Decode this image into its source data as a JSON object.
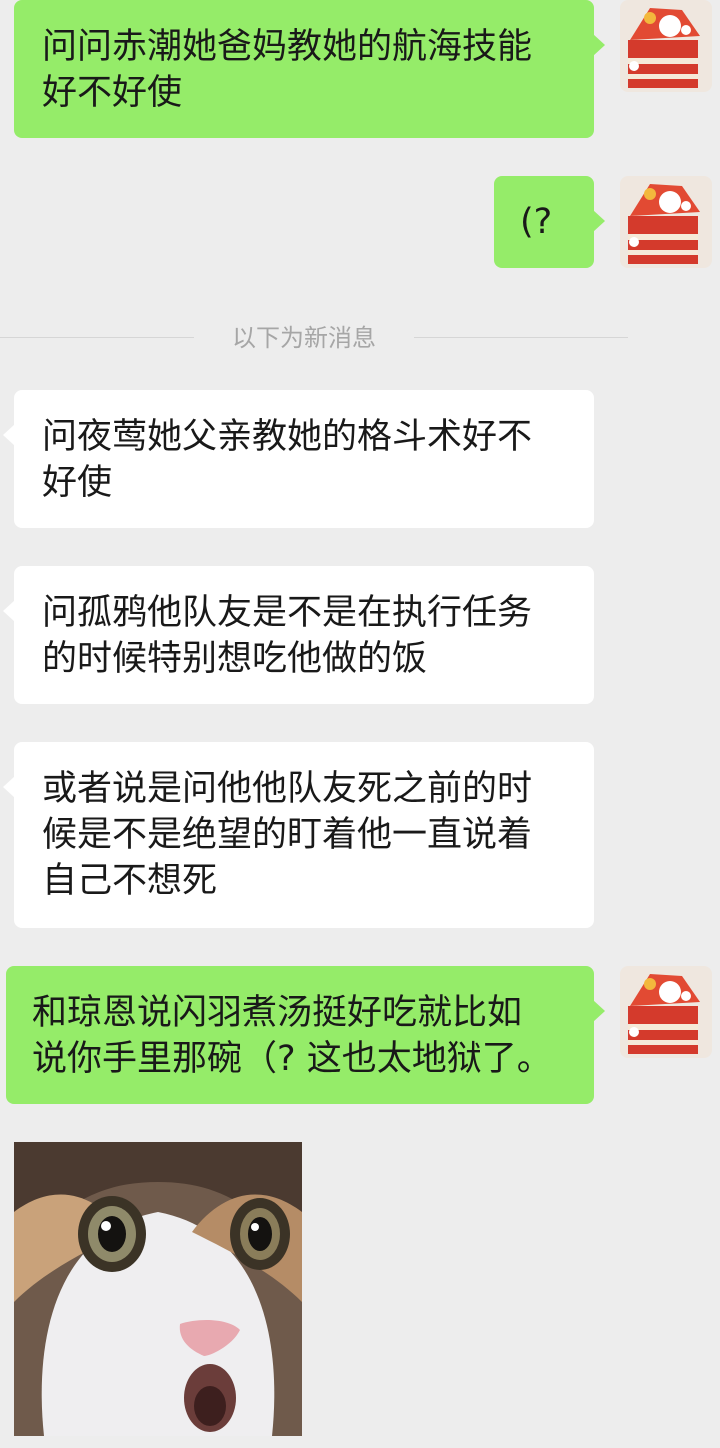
{
  "divider": {
    "label": "以下为新消息"
  },
  "messages": [
    {
      "text": "问问赤潮她爸妈教她的航海技能\n好不好使",
      "side": "out"
    },
    {
      "text": "(?",
      "side": "out"
    },
    {
      "text": "问夜莺她父亲教她的格斗术好不\n好使",
      "side": "in"
    },
    {
      "text": "问孤鸦他队友是不是在执行任务\n的时候特别想吃他做的饭",
      "side": "in"
    },
    {
      "text": "或者说是问他他队友死之前的时\n候是不是绝望的盯着他一直说着\n自己不想死",
      "side": "in"
    },
    {
      "text": "和琼恩说闪羽煮汤挺好吃就比如\n说你手里那碗（? 这也太地狱了。",
      "side": "out"
    }
  ],
  "colors": {
    "background": "#ededed",
    "outgoing_bubble": "#95ec69",
    "incoming_bubble": "#ffffff",
    "divider_text": "#a6a6a6"
  },
  "icons": {
    "self_avatar": "cake-avatar-icon",
    "sticker": "surprised-cat-sticker"
  }
}
